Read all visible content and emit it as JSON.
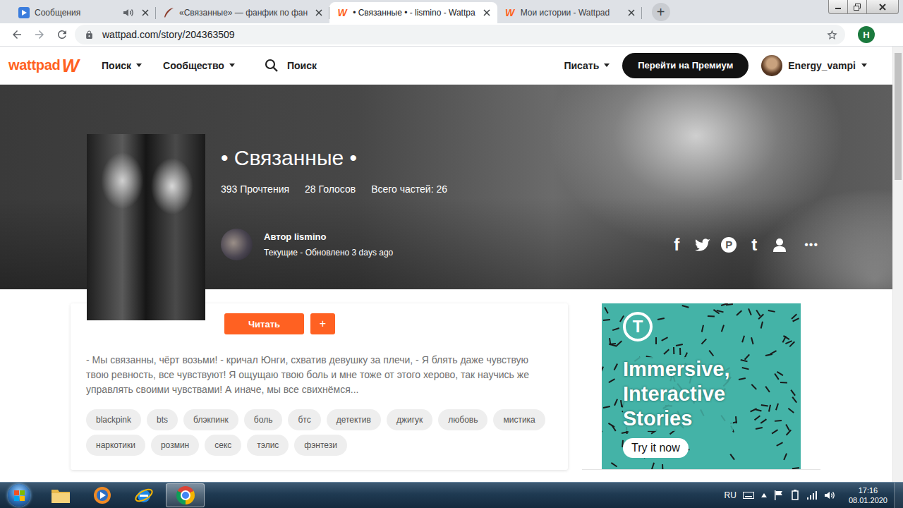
{
  "browser": {
    "tabs": [
      {
        "label": "Сообщения",
        "selected": false,
        "kind": "video",
        "audio": true
      },
      {
        "label": "«Связанные» — фанфик по фан",
        "selected": false,
        "kind": "feather",
        "audio": false
      },
      {
        "label": "• Связанные • - lismino - Wattpa",
        "selected": true,
        "kind": "wattpad",
        "audio": false
      },
      {
        "label": "Мои истории - Wattpad",
        "selected": false,
        "kind": "wattpad",
        "audio": false
      }
    ],
    "new_tab": "+",
    "url": "wattpad.com/story/204363509",
    "profile": "H"
  },
  "site_header": {
    "logo": "wattpad",
    "logo_mark": "W",
    "nav": [
      "Поиск",
      "Сообщество"
    ],
    "search": "Поиск",
    "write": "Писать",
    "premium": "Перейти на Премиум",
    "user": "Energy_vampi"
  },
  "story": {
    "title": "• Связанные •",
    "stats": [
      "393 Прочтения",
      "28 Голосов",
      "Всего частей: 26"
    ],
    "author": "Автор lismino",
    "status": "Текущие - Обновлено 3 days ago",
    "read_button": "Читать",
    "add_button": "+",
    "description": "- Мы связанны, чёрт возьми! - кричал Юнги, схватив девушку за плечи, - Я блять даже чувствую твою ревность, все чувствуют! Я ощущаю твою боль и мне тоже от этого херово, так научись же управлять своими чувствами! А иначе, мы все свихнёмся...",
    "tags": [
      "blackpink",
      "bts",
      "блэкпинк",
      "боль",
      "бтс",
      "детектив",
      "джигук",
      "любовь",
      "мистика",
      "наркотики",
      "розмин",
      "секс",
      "тэлис",
      "фэнтези"
    ]
  },
  "social": {
    "facebook": "f",
    "pinterest": "P",
    "tumblr": "t",
    "more": "•••"
  },
  "ad": {
    "logo_mark": "T",
    "headline": [
      "Immersive,",
      "Interactive",
      "Stories"
    ],
    "cta": "Try it now"
  },
  "taskbar": {
    "language": "RU",
    "time": "17:16",
    "date": "08.01.2020"
  }
}
